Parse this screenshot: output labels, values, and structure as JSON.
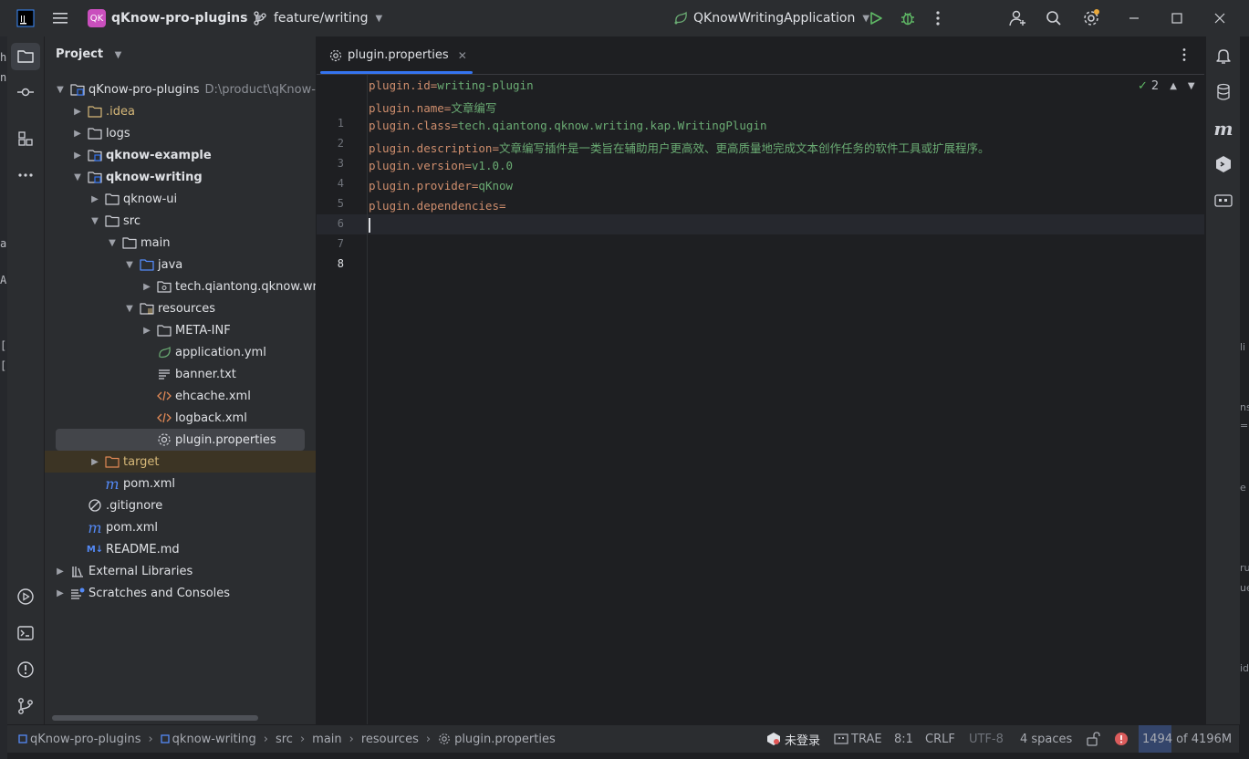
{
  "titlebar": {
    "project_badge": "QK",
    "project_name": "qKnow-pro-plugins",
    "branch": "feature/writing",
    "run_config": "QKnowWritingApplication"
  },
  "project_panel": {
    "header": "Project",
    "tree": [
      {
        "label": "qKnow-pro-plugins",
        "path": "D:\\product\\qKnow-p",
        "icon": "module-folder-icon"
      },
      {
        "label": ".idea",
        "icon": "folder-icon",
        "color": "#d5b778"
      },
      {
        "label": "logs",
        "icon": "folder-icon"
      },
      {
        "label": "qknow-example",
        "icon": "module-folder-icon"
      },
      {
        "label": "qknow-writing",
        "icon": "module-folder-icon"
      },
      {
        "label": "qknow-ui",
        "icon": "folder-icon"
      },
      {
        "label": "src",
        "icon": "folder-icon"
      },
      {
        "label": "main",
        "icon": "folder-icon"
      },
      {
        "label": "java",
        "icon": "source-folder-icon"
      },
      {
        "label": "tech.qiantong.qknow.writ",
        "icon": "package-icon"
      },
      {
        "label": "resources",
        "icon": "resources-folder-icon"
      },
      {
        "label": "META-INF",
        "icon": "folder-icon"
      },
      {
        "label": "application.yml",
        "icon": "yaml-file-icon"
      },
      {
        "label": "banner.txt",
        "icon": "text-file-icon"
      },
      {
        "label": "ehcache.xml",
        "icon": "xml-file-icon"
      },
      {
        "label": "logback.xml",
        "icon": "xml-file-icon"
      },
      {
        "label": "plugin.properties",
        "icon": "properties-file-icon"
      },
      {
        "label": "target",
        "icon": "excluded-folder-icon",
        "color": "#d5b778"
      },
      {
        "label": "pom.xml",
        "icon": "maven-icon"
      },
      {
        "label": ".gitignore",
        "icon": "ignore-file-icon"
      },
      {
        "label": "pom.xml",
        "icon": "maven-icon"
      },
      {
        "label": "README.md",
        "icon": "markdown-icon"
      },
      {
        "label": "External Libraries",
        "icon": "library-icon"
      },
      {
        "label": "Scratches and Consoles",
        "icon": "scratches-icon"
      }
    ]
  },
  "editor": {
    "tab_label": "plugin.properties",
    "inspection_count": "2",
    "lines": [
      {
        "num": "1",
        "key": "plugin.id",
        "value": "writing-plugin"
      },
      {
        "num": "2",
        "key": "plugin.name",
        "value": "文章编写"
      },
      {
        "num": "3",
        "key": "plugin.class",
        "value": "tech.qiantong.qknow.writing.kap.WritingPlugin"
      },
      {
        "num": "4",
        "key": "plugin.description",
        "value": "文章编写插件是一类旨在辅助用户更高效、更高质量地完成文本创作任务的软件工具或扩展程序。"
      },
      {
        "num": "5",
        "key": "plugin.version",
        "value": "v1.0.0"
      },
      {
        "num": "6",
        "key": "plugin.provider",
        "value": "qKnow"
      },
      {
        "num": "7",
        "key": "plugin.dependencies",
        "value": ""
      },
      {
        "num": "8",
        "key": "",
        "value": ""
      }
    ]
  },
  "left_strip": [
    "h",
    "n",
    "a",
    "A",
    "[",
    "["
  ],
  "right_strip": [
    "li",
    "ns",
    "=",
    "e",
    "ru",
    "ue",
    "id"
  ],
  "statusbar": {
    "crumbs": [
      "qKnow-pro-plugins",
      "qknow-writing",
      "src",
      "main",
      "resources",
      "plugin.properties"
    ],
    "login": "未登录",
    "trae": "TRAE",
    "position": "8:1",
    "line_sep": "CRLF",
    "encoding": "UTF-8",
    "indent": "4 spaces",
    "mem_used": "1494",
    "mem_rest": "of 4196M"
  },
  "colors": {
    "accent": "#3574f0",
    "keyword": "#cf8e6d",
    "string": "#6aab73",
    "badge": "#c94fbd"
  }
}
